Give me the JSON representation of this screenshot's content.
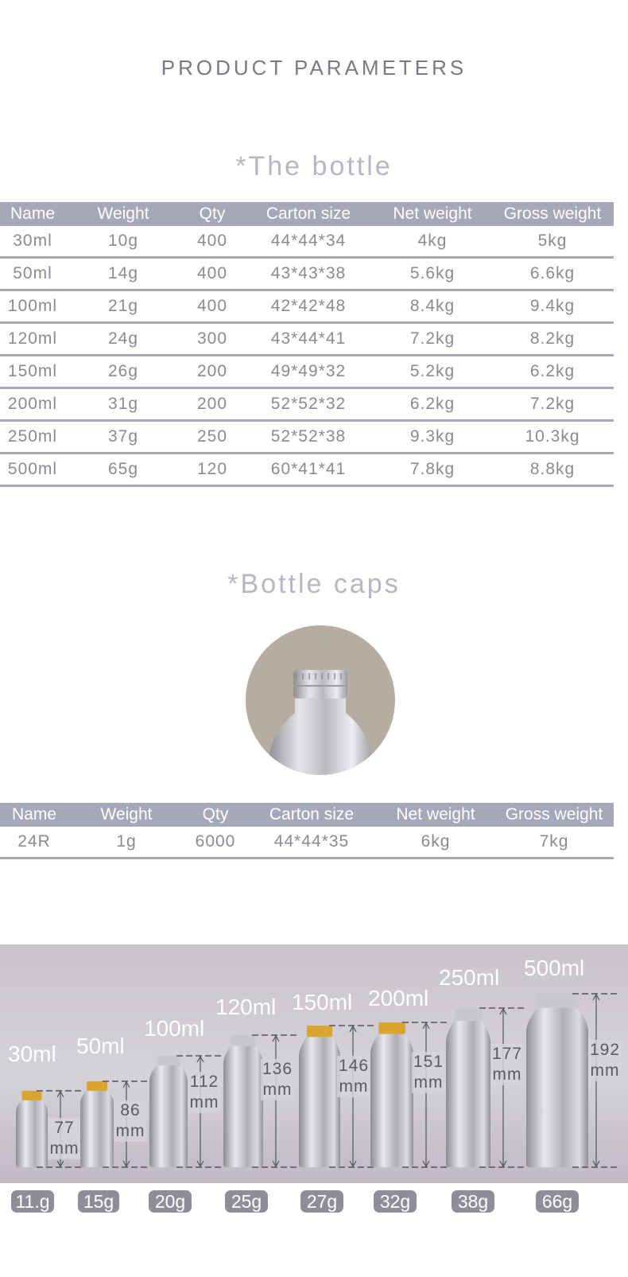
{
  "page_title": "PRODUCT PARAMETERS",
  "bottle_section": {
    "title": "*The bottle",
    "headers": [
      "Name",
      "Weight",
      "Qty",
      "Carton size",
      "Net weight",
      "Gross weight"
    ],
    "rows": [
      [
        "30ml",
        "10g",
        "400",
        "44*44*34",
        "4kg",
        "5kg"
      ],
      [
        "50ml",
        "14g",
        "400",
        "43*43*38",
        "5.6kg",
        "6.6kg"
      ],
      [
        "100ml",
        "21g",
        "400",
        "42*42*48",
        "8.4kg",
        "9.4kg"
      ],
      [
        "120ml",
        "24g",
        "300",
        "43*44*41",
        "7.2kg",
        "8.2kg"
      ],
      [
        "150ml",
        "26g",
        "200",
        "49*49*32",
        "5.2kg",
        "6.2kg"
      ],
      [
        "200ml",
        "31g",
        "200",
        "52*52*32",
        "6.2kg",
        "7.2kg"
      ],
      [
        "250ml",
        "37g",
        "250",
        "52*52*38",
        "9.3kg",
        "10.3kg"
      ],
      [
        "500ml",
        "65g",
        "120",
        "60*41*41",
        "7.8kg",
        "8.8kg"
      ]
    ]
  },
  "cap_section": {
    "title": "*Bottle caps",
    "headers": [
      "Name",
      "Weight",
      "Qty",
      "Carton size",
      "Net weight",
      "Gross weight"
    ],
    "rows": [
      [
        "24R",
        "1g",
        "6000",
        "44*44*35",
        "6kg",
        "7kg"
      ]
    ]
  },
  "size_chart": {
    "bottles": [
      {
        "volume": "30ml",
        "height_num": "77",
        "height_unit": "mm",
        "weight": "11.g",
        "cap": "gold"
      },
      {
        "volume": "50ml",
        "height_num": "86",
        "height_unit": "mm",
        "weight": "15g",
        "cap": "gold"
      },
      {
        "volume": "100ml",
        "height_num": "112",
        "height_unit": "mm",
        "weight": "20g",
        "cap": "silver"
      },
      {
        "volume": "120ml",
        "height_num": "136",
        "height_unit": "mm",
        "weight": "25g",
        "cap": "silver"
      },
      {
        "volume": "150ml",
        "height_num": "146",
        "height_unit": "mm",
        "weight": "27g",
        "cap": "gold"
      },
      {
        "volume": "200ml",
        "height_num": "151",
        "height_unit": "mm",
        "weight": "32g",
        "cap": "gold"
      },
      {
        "volume": "250ml",
        "height_num": "177",
        "height_unit": "mm",
        "weight": "38g",
        "cap": "silver"
      },
      {
        "volume": "500ml",
        "height_num": "192",
        "height_unit": "mm",
        "weight": "66g",
        "cap": "silver"
      }
    ]
  },
  "colors": {
    "header_bg": "#a6a7b9",
    "text": "#8a8a92",
    "section_title": "#b6b6c6",
    "badge_bg": "#8e8e9a",
    "cap_gold": "#d9a430",
    "cap_silver": "#c8c8cc"
  }
}
